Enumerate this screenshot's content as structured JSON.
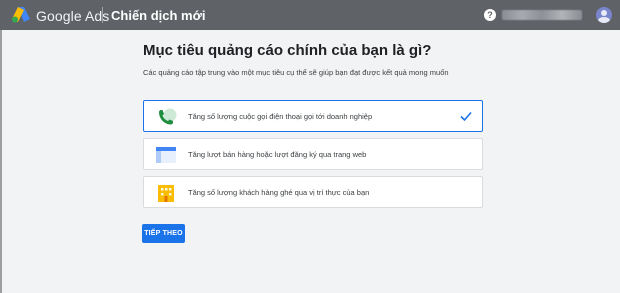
{
  "header": {
    "brand": "Google Ads",
    "campaign_title": "Chiến dịch mới",
    "help_glyph": "?"
  },
  "main": {
    "heading": "Mục tiêu quảng cáo chính của bạn là gì?",
    "subtitle": "Các quảng cáo tập trung vào một mục tiêu cụ thể sẽ giúp bạn đạt được kết quả mong muốn",
    "options": [
      {
        "label": "Tăng số lượng cuộc gọi điện thoại gọi tới doanh nghiệp",
        "icon": "phone-call-icon",
        "selected": true
      },
      {
        "label": "Tăng lượt bán hàng hoặc lượt đăng ký qua trang web",
        "icon": "webpage-icon",
        "selected": false
      },
      {
        "label": "Tăng số lượng khách hàng ghé qua vị trí thực của bạn",
        "icon": "storefront-icon",
        "selected": false
      }
    ],
    "next_button": "TIẾP THEO"
  },
  "colors": {
    "topbar": "#5f6368",
    "accent": "#1a73e8",
    "background": "#f1f3f4"
  }
}
